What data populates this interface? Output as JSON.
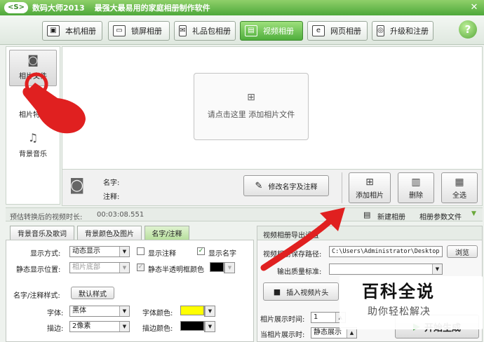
{
  "titlebar": {
    "logo": "<S>",
    "title": "数码大师2013",
    "slogan": "最强大最易用的家庭相册制作软件",
    "close_glyph": "✕"
  },
  "tabs": [
    {
      "label": "本机相册",
      "icon": "photo-icon",
      "glyph": "▣"
    },
    {
      "label": "锁屏相册",
      "icon": "monitor-icon",
      "glyph": "▭"
    },
    {
      "label": "礼品包相册",
      "icon": "gift-icon",
      "glyph": "✉"
    },
    {
      "label": "视频相册",
      "icon": "film-icon",
      "glyph": "▤"
    },
    {
      "label": "网页相册",
      "icon": "browser-icon",
      "glyph": "e"
    },
    {
      "label": "升级和注册",
      "icon": "globe-icon",
      "glyph": "◎"
    }
  ],
  "active_tab": "视频相册",
  "help_glyph": "?",
  "leftnav": [
    {
      "label": "相片文件",
      "icon": "camera-icon",
      "glyph": "◙"
    },
    {
      "label": "相片特效",
      "icon": "effects-icon",
      "glyph": "✦"
    },
    {
      "label": "背景音乐",
      "icon": "music-icon",
      "glyph": "♫"
    }
  ],
  "drop_area": {
    "plus_glyph": "⊞",
    "text": "请点击这里 添加相片文件"
  },
  "info": {
    "name_label": "名字:",
    "note_label": "注释:",
    "edit_button": "修改名字及注释",
    "add_photo": "添加相片",
    "delete": "删除",
    "select_all": "全选"
  },
  "status": {
    "duration_label": "预估转换后的视频时长:",
    "duration_value": "00:03:08.551",
    "new_album": "新建相册",
    "params_file": "相册参数文件"
  },
  "left_panel": {
    "tabs": [
      "背景音乐及歌词",
      "背景颜色及图片",
      "名字/注释"
    ],
    "display_mode_label": "显示方式:",
    "display_mode_value": "动态显示",
    "show_note": "显示注释",
    "show_name": "显示名字",
    "static_pos_label": "静态显示位置:",
    "static_pos_value": "相片底部",
    "static_semi": "静态半透明框颜色",
    "style_label": "名字/注释样式:",
    "default_style": "默认样式",
    "font_label": "字体:",
    "font_value": "黑体",
    "font_color_label": "字体颜色:",
    "stroke_label": "描边:",
    "stroke_value": "2像素",
    "stroke_color_label": "描边颜色:"
  },
  "right_panel": {
    "title": "视频相册导出设置",
    "path_label": "视频相册保存路径:",
    "path_value": "C:\\Users\\Administrator\\Desktop",
    "browse": "浏览",
    "quality_label": "输出质量标准:",
    "insert_header": "插入视频片头",
    "show_time_label": "相片展示时间:",
    "show_time_value": "1",
    "when_shown_label": "当相片展示时:",
    "when_shown_value": "静态展示",
    "start_button": "开始生成"
  },
  "watermark": {
    "title": "百科全说",
    "subtitle": "助你轻松解决"
  },
  "colors": {
    "accent": "#4fae3c",
    "font_color": "#ffff00",
    "stroke_color": "#000000",
    "semi_frame_color": "#000000",
    "arrow": "#e02020"
  }
}
